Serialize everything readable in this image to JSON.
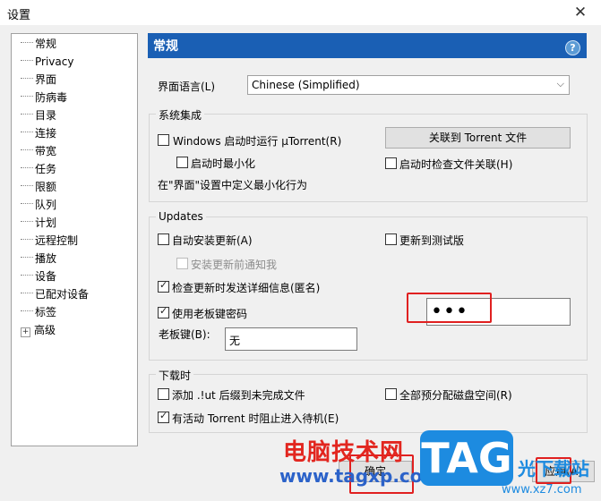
{
  "window": {
    "title": "设置",
    "close_glyph": "✕"
  },
  "tree": {
    "items": [
      {
        "label": "常规",
        "selected": true
      },
      {
        "label": "Privacy"
      },
      {
        "label": "界面"
      },
      {
        "label": "防病毒"
      },
      {
        "label": "目录"
      },
      {
        "label": "连接"
      },
      {
        "label": "带宽"
      },
      {
        "label": "任务"
      },
      {
        "label": "限额"
      },
      {
        "label": "队列"
      },
      {
        "label": "计划"
      },
      {
        "label": "远程控制"
      },
      {
        "label": "播放"
      },
      {
        "label": "设备"
      },
      {
        "label": "已配对设备"
      },
      {
        "label": "标签"
      },
      {
        "label": "高级",
        "expander": "+"
      }
    ]
  },
  "panel": {
    "title": "常规",
    "help_glyph": "?",
    "language_label": "界面语言(L)",
    "language_value": "Chinese (Simplified)",
    "dropdown_glyph": "⌵"
  },
  "system": {
    "title": "系统集成",
    "start_with_windows": "Windows 启动时运行 µTorrent(R)",
    "start_minimized": "启动时最小化",
    "associate_button": "关联到 Torrent 文件",
    "check_association": "启动时检查文件关联(H)",
    "minimize_note": "在\"界面\"设置中定义最小化行为"
  },
  "updates": {
    "title": "Updates",
    "auto_install": "自动安装更新(A)",
    "beta": "更新到测试版",
    "notify_before": "安装更新前通知我",
    "send_info": "检查更新时发送详细信息(匿名)",
    "boss_key_use": "使用老板键密码",
    "boss_key_label": "老板键(B):",
    "boss_key_value": "无",
    "password_value": "•••"
  },
  "download": {
    "title": "下载时",
    "add_ut": "添加 .!ut 后缀到未完成文件",
    "preallocate": "全部预分配磁盘空间(R)",
    "prevent_standby": "有活动 Torrent 时阻止进入待机(E)"
  },
  "footer": {
    "ok_label": "确定",
    "apply_label": "应用(A)"
  },
  "watermark": {
    "site_name": "电脑技术网",
    "site_url": "www.tagxp.com",
    "logo": "TAG",
    "side_text": "光下载站",
    "side_url": "www.xz7.com"
  },
  "colors": {
    "header": "#1a5fb4",
    "highlight_box": "#e02020"
  }
}
